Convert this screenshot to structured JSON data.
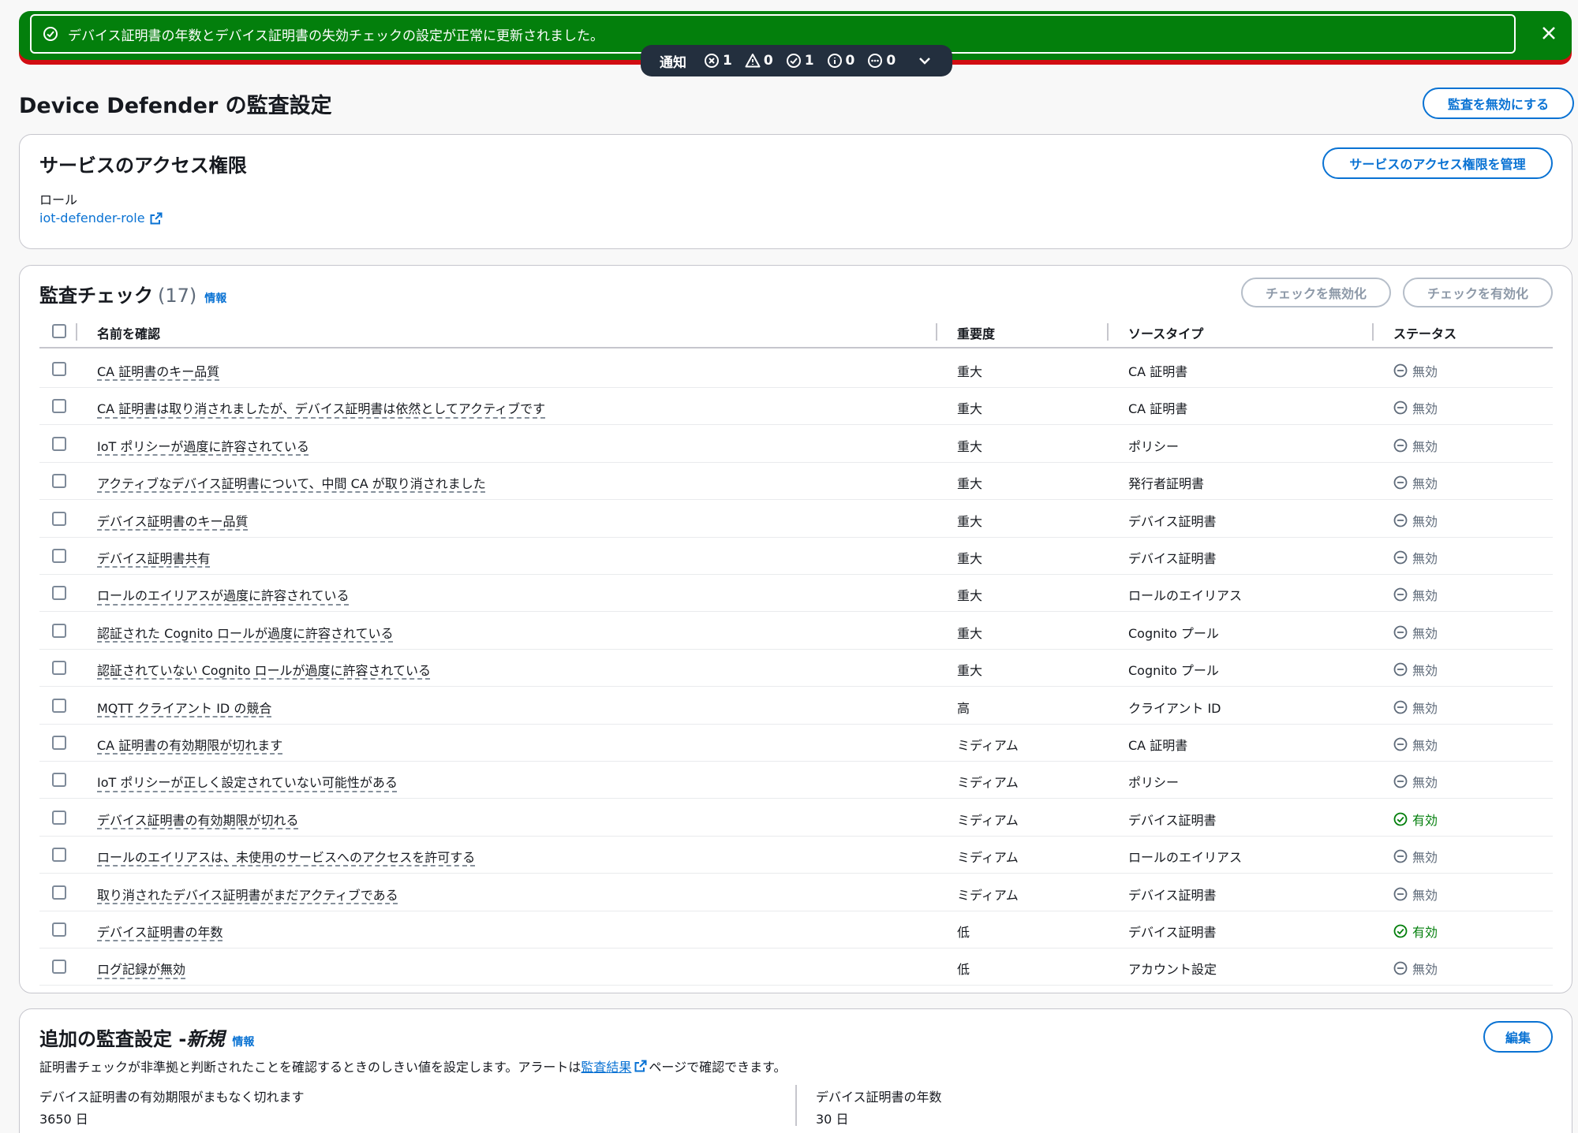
{
  "flash": {
    "message": "デバイス証明書の年数とデバイス証明書の失効チェックの設定が正常に更新されました。"
  },
  "notifications": {
    "label": "通知",
    "error_count": "1",
    "warning_count": "0",
    "success_count": "1",
    "info_count": "0",
    "progress_count": "0"
  },
  "page": {
    "title": "Device Defender の監査設定",
    "disable_audit_label": "監査を無効にする"
  },
  "service_access": {
    "title": "サービスのアクセス権限",
    "manage_label": "サービスのアクセス権限を管理",
    "role_label": "ロール",
    "role_value": "iot-defender-role"
  },
  "audit_checks": {
    "title": "監査チェック",
    "count": "(17)",
    "info_label": "情報",
    "disable_label": "チェックを無効化",
    "enable_label": "チェックを有効化",
    "columns": {
      "name": "名前を確認",
      "severity": "重要度",
      "source": "ソースタイプ",
      "status": "ステータス"
    },
    "rows": [
      {
        "name": "CA 証明書のキー品質",
        "severity": "重大",
        "source": "CA 証明書",
        "status": "無効",
        "enabled": false
      },
      {
        "name": "CA 証明書は取り消されましたが、デバイス証明書は依然としてアクティブです",
        "severity": "重大",
        "source": "CA 証明書",
        "status": "無効",
        "enabled": false
      },
      {
        "name": "IoT ポリシーが過度に許容されている",
        "severity": "重大",
        "source": "ポリシー",
        "status": "無効",
        "enabled": false
      },
      {
        "name": "アクティブなデバイス証明書について、中間 CA が取り消されました",
        "severity": "重大",
        "source": "発行者証明書",
        "status": "無効",
        "enabled": false
      },
      {
        "name": "デバイス証明書のキー品質",
        "severity": "重大",
        "source": "デバイス証明書",
        "status": "無効",
        "enabled": false
      },
      {
        "name": "デバイス証明書共有",
        "severity": "重大",
        "source": "デバイス証明書",
        "status": "無効",
        "enabled": false
      },
      {
        "name": "ロールのエイリアスが過度に許容されている",
        "severity": "重大",
        "source": "ロールのエイリアス",
        "status": "無効",
        "enabled": false
      },
      {
        "name": "認証された Cognito ロールが過度に許容されている",
        "severity": "重大",
        "source": "Cognito プール",
        "status": "無効",
        "enabled": false
      },
      {
        "name": "認証されていない Cognito ロールが過度に許容されている",
        "severity": "重大",
        "source": "Cognito プール",
        "status": "無効",
        "enabled": false
      },
      {
        "name": "MQTT クライアント ID の競合",
        "severity": "高",
        "source": "クライアント ID",
        "status": "無効",
        "enabled": false
      },
      {
        "name": "CA 証明書の有効期限が切れます",
        "severity": "ミディアム",
        "source": "CA 証明書",
        "status": "無効",
        "enabled": false
      },
      {
        "name": "IoT ポリシーが正しく設定されていない可能性がある",
        "severity": "ミディアム",
        "source": "ポリシー",
        "status": "無効",
        "enabled": false
      },
      {
        "name": "デバイス証明書の有効期限が切れる",
        "severity": "ミディアム",
        "source": "デバイス証明書",
        "status": "有効",
        "enabled": true
      },
      {
        "name": "ロールのエイリアスは、未使用のサービスへのアクセスを許可する",
        "severity": "ミディアム",
        "source": "ロールのエイリアス",
        "status": "無効",
        "enabled": false
      },
      {
        "name": "取り消されたデバイス証明書がまだアクティブである",
        "severity": "ミディアム",
        "source": "デバイス証明書",
        "status": "無効",
        "enabled": false
      },
      {
        "name": "デバイス証明書の年数",
        "severity": "低",
        "source": "デバイス証明書",
        "status": "有効",
        "enabled": true
      },
      {
        "name": "ログ記録が無効",
        "severity": "低",
        "source": "アカウント設定",
        "status": "無効",
        "enabled": false
      }
    ]
  },
  "additional": {
    "title_prefix": "追加の監査設定 - ",
    "title_new": "新規",
    "info_label": "情報",
    "edit_label": "編集",
    "desc_before": "証明書チェックが非準拠と判断されたことを確認するときのしきい値を設定します。アラートは",
    "desc_link": "監査結果",
    "desc_after": "ページで確認できます。",
    "expiry_label": "デバイス証明書の有効期限がまもなく切れます",
    "expiry_value": "3650 日",
    "age_label": "デバイス証明書の年数",
    "age_value": "30 日"
  },
  "colors": {
    "success": "#037f0c",
    "error": "#d20d12",
    "link": "#0972d3",
    "notification_bar": "#232f3e"
  }
}
